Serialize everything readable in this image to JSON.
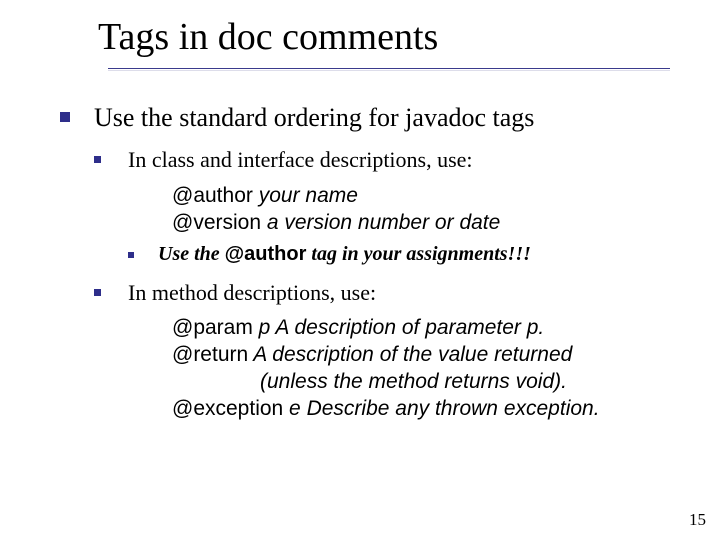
{
  "title": "Tags in doc comments",
  "lvl1": {
    "text": "Use the standard ordering for javadoc tags"
  },
  "lvl2a": {
    "text": "In class and interface descriptions, use:",
    "code1_kw": "@author",
    "code1_rest": "   your name",
    "code2_kw": "@version",
    "code2_rest": "   a version number or date",
    "sub_prefix": "Use the ",
    "sub_kw": "@author",
    "sub_suffix": " tag in your assignments!!!"
  },
  "lvl2b": {
    "text": "In method descriptions, use:",
    "c1_kw": "@param",
    "c1_rest": " p   A description of parameter p.",
    "c2_kw": "@return",
    "c2_rest": "   A description of the value returned",
    "c2_cont": "(unless the method returns void).",
    "c3_kw": "@exception",
    "c3_rest": " e   Describe any thrown exception."
  },
  "slide_number": "15"
}
